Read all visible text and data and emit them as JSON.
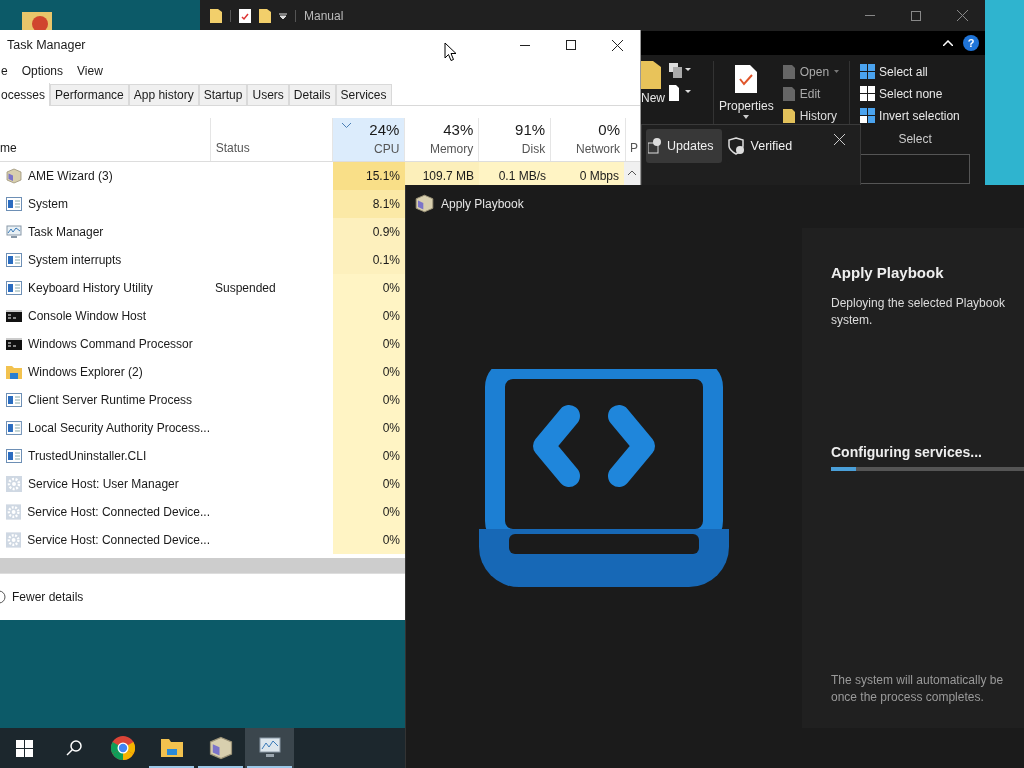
{
  "explorer": {
    "title": "Manual",
    "new_label": "New",
    "properties_label": "Properties",
    "open_actions": [
      "Open",
      "Edit",
      "History"
    ],
    "select_actions": [
      "Select all",
      "Select none",
      "Invert selection"
    ],
    "select_group": "Select",
    "help": "?"
  },
  "toast": {
    "buttons": [
      {
        "kind": "updates",
        "label": "Updates",
        "selected": true
      },
      {
        "kind": "verified",
        "label": "Verified",
        "selected": false
      }
    ]
  },
  "task_manager": {
    "title": "Task Manager",
    "menu": [
      "e",
      "Options",
      "View"
    ],
    "tabs": [
      {
        "label": "ocesses",
        "selected": true
      },
      {
        "label": "Performance",
        "selected": false
      },
      {
        "label": "App history",
        "selected": false
      },
      {
        "label": "Startup",
        "selected": false
      },
      {
        "label": "Users",
        "selected": false
      },
      {
        "label": "Details",
        "selected": false
      },
      {
        "label": "Services",
        "selected": false
      }
    ],
    "name_column": "me",
    "status_column": "Status",
    "metric_columns": [
      {
        "value": "24%",
        "label": "CPU",
        "sorted": true
      },
      {
        "value": "43%",
        "label": "Memory",
        "sorted": false
      },
      {
        "value": "91%",
        "label": "Disk",
        "sorted": false
      },
      {
        "value": "0%",
        "label": "Network",
        "sorted": false
      }
    ],
    "cut_column": "P",
    "rows": [
      {
        "kind": "cube",
        "name": "AME Wizard (3)",
        "cpu": "15.1%",
        "color": "#f9df88",
        "memory": "109.7 MB",
        "disk": "0.1 MB/s",
        "network": "0 Mbps"
      },
      {
        "kind": "window",
        "name": "System",
        "cpu": "8.1%",
        "color": "#fbe9a6"
      },
      {
        "kind": "monitor",
        "name": "Task Manager",
        "cpu": "0.9%",
        "color": "#fdf0bd"
      },
      {
        "kind": "window",
        "name": "System interrupts",
        "cpu": "0.1%",
        "color": "#fdf0bd"
      },
      {
        "kind": "window",
        "name": "Keyboard History Utility",
        "status": "Suspended",
        "cpu": "0%",
        "color": "#fff4c4"
      },
      {
        "kind": "console",
        "name": "Console Window Host",
        "cpu": "0%",
        "color": "#fff4c4"
      },
      {
        "kind": "console",
        "name": "Windows Command Processor",
        "cpu": "0%",
        "color": "#fff4c4"
      },
      {
        "kind": "folder",
        "name": "Windows Explorer (2)",
        "cpu": "0%",
        "color": "#fff4c4"
      },
      {
        "kind": "window",
        "name": "Client Server Runtime Process",
        "cpu": "0%",
        "color": "#fff4c4"
      },
      {
        "kind": "window",
        "name": "Local Security Authority Process...",
        "cpu": "0%",
        "color": "#fff4c4"
      },
      {
        "kind": "window",
        "name": "TrustedUninstaller.CLI",
        "cpu": "0%",
        "color": "#fff4c4"
      },
      {
        "kind": "gear",
        "name": "Service Host: User Manager",
        "cpu": "0%",
        "color": "#fff4c4"
      },
      {
        "kind": "gear",
        "name": "Service Host: Connected Device...",
        "cpu": "0%",
        "color": "#fff4c4"
      },
      {
        "kind": "gear",
        "name": "Service Host: Connected Device...",
        "cpu": "0%",
        "color": "#fff4c4"
      }
    ],
    "footer": "Fewer details"
  },
  "playbook": {
    "title": "Apply Playbook",
    "heading": "Apply Playbook",
    "description": [
      "Deploying the selected Playbook",
      "system."
    ],
    "status": "Configuring services...",
    "level": 0.13,
    "note": [
      "The system will automatically be",
      "once the process completes."
    ]
  },
  "taskbar": {
    "apps": [
      {
        "kind": "start",
        "running": false,
        "selected": false
      },
      {
        "kind": "search",
        "running": false,
        "selected": false
      },
      {
        "kind": "chrome",
        "running": false,
        "selected": false
      },
      {
        "kind": "explorer",
        "running": true,
        "selected": false
      },
      {
        "kind": "cube",
        "running": true,
        "selected": false
      },
      {
        "kind": "monitor",
        "running": true,
        "selected": true
      }
    ]
  }
}
